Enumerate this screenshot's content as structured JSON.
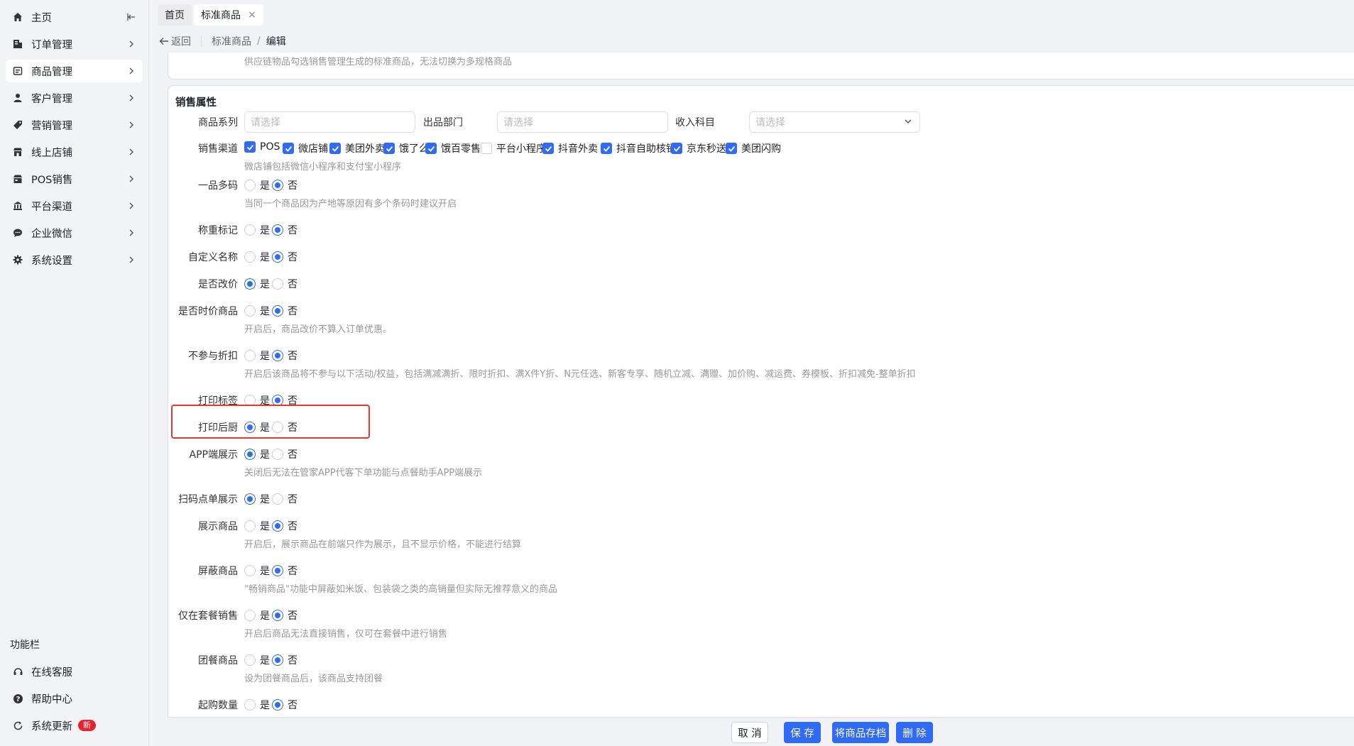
{
  "sidebar": {
    "items": [
      {
        "label": "主页",
        "icon": "home-icon"
      },
      {
        "label": "订单管理",
        "icon": "order-icon"
      },
      {
        "label": "商品管理",
        "icon": "product-icon"
      },
      {
        "label": "客户管理",
        "icon": "customer-icon"
      },
      {
        "label": "营销管理",
        "icon": "tag-icon"
      },
      {
        "label": "线上店铺",
        "icon": "store-icon"
      },
      {
        "label": "POS销售",
        "icon": "pos-icon"
      },
      {
        "label": "平台渠道",
        "icon": "bank-icon"
      },
      {
        "label": "企业微信",
        "icon": "chat-icon"
      },
      {
        "label": "系统设置",
        "icon": "gear-icon"
      }
    ],
    "func_title": "功能栏",
    "func_items": [
      {
        "label": "在线客服",
        "icon": "headset-icon"
      },
      {
        "label": "帮助中心",
        "icon": "help-icon"
      },
      {
        "label": "系统更新",
        "icon": "refresh-icon",
        "badge": "新"
      }
    ]
  },
  "tabs": [
    {
      "label": "首页"
    },
    {
      "label": "标准商品",
      "close": "×"
    }
  ],
  "breadcrumb": {
    "back": "返回",
    "parent": "标准商品",
    "slash": "/",
    "current": "编辑"
  },
  "top_tip": "供应链物品勾选销售管理生成的标准商品，无法切换为多规格商品",
  "section": {
    "title": "销售属性",
    "selects": [
      {
        "label": "商品系列",
        "placeholder": "请选择"
      },
      {
        "label": "出品部门",
        "placeholder": "请选择"
      },
      {
        "label": "收入科目",
        "placeholder": "请选择"
      }
    ],
    "channel_label": "销售渠道",
    "channels": [
      {
        "label": "POS",
        "checked": true
      },
      {
        "label": "微店铺",
        "checked": true
      },
      {
        "label": "美团外卖",
        "checked": true
      },
      {
        "label": "饿了么",
        "checked": true
      },
      {
        "label": "饿百零售",
        "checked": true
      },
      {
        "label": "平台小程序",
        "checked": false
      },
      {
        "label": "抖音外卖",
        "checked": true
      },
      {
        "label": "抖音自助核销",
        "checked": true
      },
      {
        "label": "京东秒送",
        "checked": true
      },
      {
        "label": "美团闪购",
        "checked": true
      }
    ],
    "channel_help": "微店铺包括微信小程序和支付宝小程序",
    "yes": "是",
    "no": "否",
    "rows": [
      {
        "label": "一品多码",
        "value": "否",
        "help": "当同一个商品因为产地等原因有多个条码时建议开启"
      },
      {
        "label": "称重标记",
        "value": "否",
        "help": ""
      },
      {
        "label": "自定义名称",
        "value": "否",
        "help": ""
      },
      {
        "label": "是否改价",
        "value": "是",
        "help": ""
      },
      {
        "label": "是否时价商品",
        "value": "否",
        "help": "开启后，商品改价不算入订单优惠。"
      },
      {
        "label": "不参与折扣",
        "value": "否",
        "help": "开启后该商品将不参与以下活动/权益，包括满减满折、限时折扣、满X件Y折、N元任选、新客专享、随机立减、满赠、加价购、减运费、券模板、折扣减免-整单折扣"
      },
      {
        "label": "打印标签",
        "value": "否",
        "help": ""
      },
      {
        "label": "打印后厨",
        "value": "是",
        "help": ""
      },
      {
        "label": "APP端展示",
        "value": "是",
        "help": "关闭后无法在管家APP代客下单功能与点餐助手APP端展示"
      },
      {
        "label": "扫码点单展示",
        "value": "是",
        "help": ""
      },
      {
        "label": "展示商品",
        "value": "否",
        "help": "开启后，展示商品在前端只作为展示，且不显示价格，不能进行结算"
      },
      {
        "label": "屏蔽商品",
        "value": "否",
        "help": "\"畅销商品\"功能中屏蔽如米饭、包装袋之类的高销量但实际无推荐意义的商品"
      },
      {
        "label": "仅在套餐销售",
        "value": "否",
        "help": "开启后商品无法直接销售，仅可在套餐中进行销售"
      },
      {
        "label": "团餐商品",
        "value": "否",
        "help": "设为团餐商品后，该商品支持团餐"
      },
      {
        "label": "起购数量",
        "value": "否",
        "help": ""
      }
    ]
  },
  "footer": {
    "cancel": "取 消",
    "save": "保 存",
    "archive": "将商品存档",
    "delete": "删 除"
  },
  "colors": {
    "primary": "#2f6bf5",
    "highlight": "#e23a2e",
    "badge": "#e8222e"
  }
}
